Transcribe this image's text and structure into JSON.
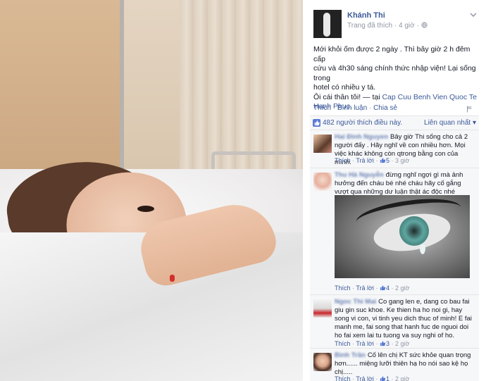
{
  "post": {
    "author": "Khánh Thi",
    "meta": "Trang đã thích · 4 giờ · ",
    "text_lines": [
      "Mới khỏi ốm được 2 ngày . Thì bây giờ 2 h đêm cấp",
      "cứu và 4h30 sáng chính thức nhập viện! Lại sống trong",
      "hotel có nhiều y tá.",
      "Ôi cái thân tôi! — tại "
    ],
    "place": "Cap Cuu Benh Vien Quoc Te Hanh Phuc",
    "place_suffix": ".",
    "actions": {
      "like": "Thích",
      "comment": "Bình luận",
      "share": "Chia sẻ",
      "sep": " · "
    }
  },
  "likes": {
    "text": "482 người thích điều này.",
    "relevance": "Liên quan nhất ▾"
  },
  "comments": [
    {
      "author": "Hai Đình Nguyen",
      "text": "Bây giờ Thi sống cho cả 2 người đấy . Hãy nghĩ về con nhiều hơn. Mọi việc khác không còn qtrong bằng con của mình.",
      "like": "Thích",
      "reply": "Trả lời",
      "likes": "5",
      "time": "3 giờ"
    },
    {
      "author": "Thu Hà Nguyễn",
      "text": "đừng nghĩ ngợi gì mà ảnh hưởng đến cháu bé nhé cháu hãy cố gắng vượt qua những dư luận thật ác độc nhé",
      "like": "Thích",
      "reply": "Trả lời",
      "likes": "4",
      "time": "2 giờ"
    },
    {
      "author": "Ngoc Thi Mai",
      "text": "Co gang len e, dang co bau fai giu gin suc khoe. Ke thien ha ho noi gi, hay song vi con, vi tinh yeu dich thuc of minh! E fai manh me, fai song that hanh fuc de nguoi doi ho fai xem lai tu tuong va suy nghi of ho.",
      "like": "Thích",
      "reply": "Trả lời",
      "likes": "3",
      "time": "2 giờ"
    },
    {
      "author": "Bình Trần",
      "text": "Cố lên chị KT sức khỏe quan trọng hơn...... miệng lưỡi thiên hạ ho nói sao kệ họ chị.....",
      "like": "Thích",
      "reply": "Trả lời",
      "likes": "1",
      "time": "2 giờ"
    }
  ],
  "comment_foot_sep": " · ",
  "colors": {
    "link": "#3b5998",
    "meta": "#9197a3",
    "comment_bg": "#f6f7f9"
  },
  "icons": [
    "globe-icon",
    "chevron-down-icon",
    "flag-icon",
    "thumbs-up-icon"
  ]
}
